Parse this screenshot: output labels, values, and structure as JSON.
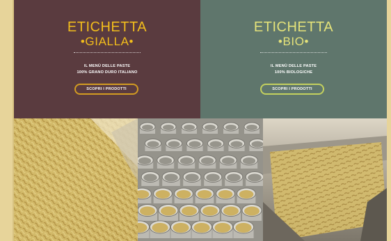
{
  "cards": [
    {
      "brand_line1": "ETICHETTA",
      "brand_line2": "•GIALLA•",
      "subtitle_line1": "IL MENÙ DELLE PASTE",
      "subtitle_line2": "100% GRANO DURO ITALIANO",
      "button_label": "SCOPRI I PRODOTTI"
    },
    {
      "brand_line1": "ETICHETTA",
      "brand_line2": "•BIO•",
      "subtitle_line1": "IL MENÙ DELLE PASTE",
      "subtitle_line2": "100% BIOLOGICHE",
      "button_label": "SCOPRI I PRODOTTI"
    }
  ],
  "colors": {
    "gialla_panel": "#5a3b3f",
    "bio_panel": "#5f766c",
    "gialla_accent": "#f2bd1c",
    "bio_accent": "#e4e27a"
  }
}
